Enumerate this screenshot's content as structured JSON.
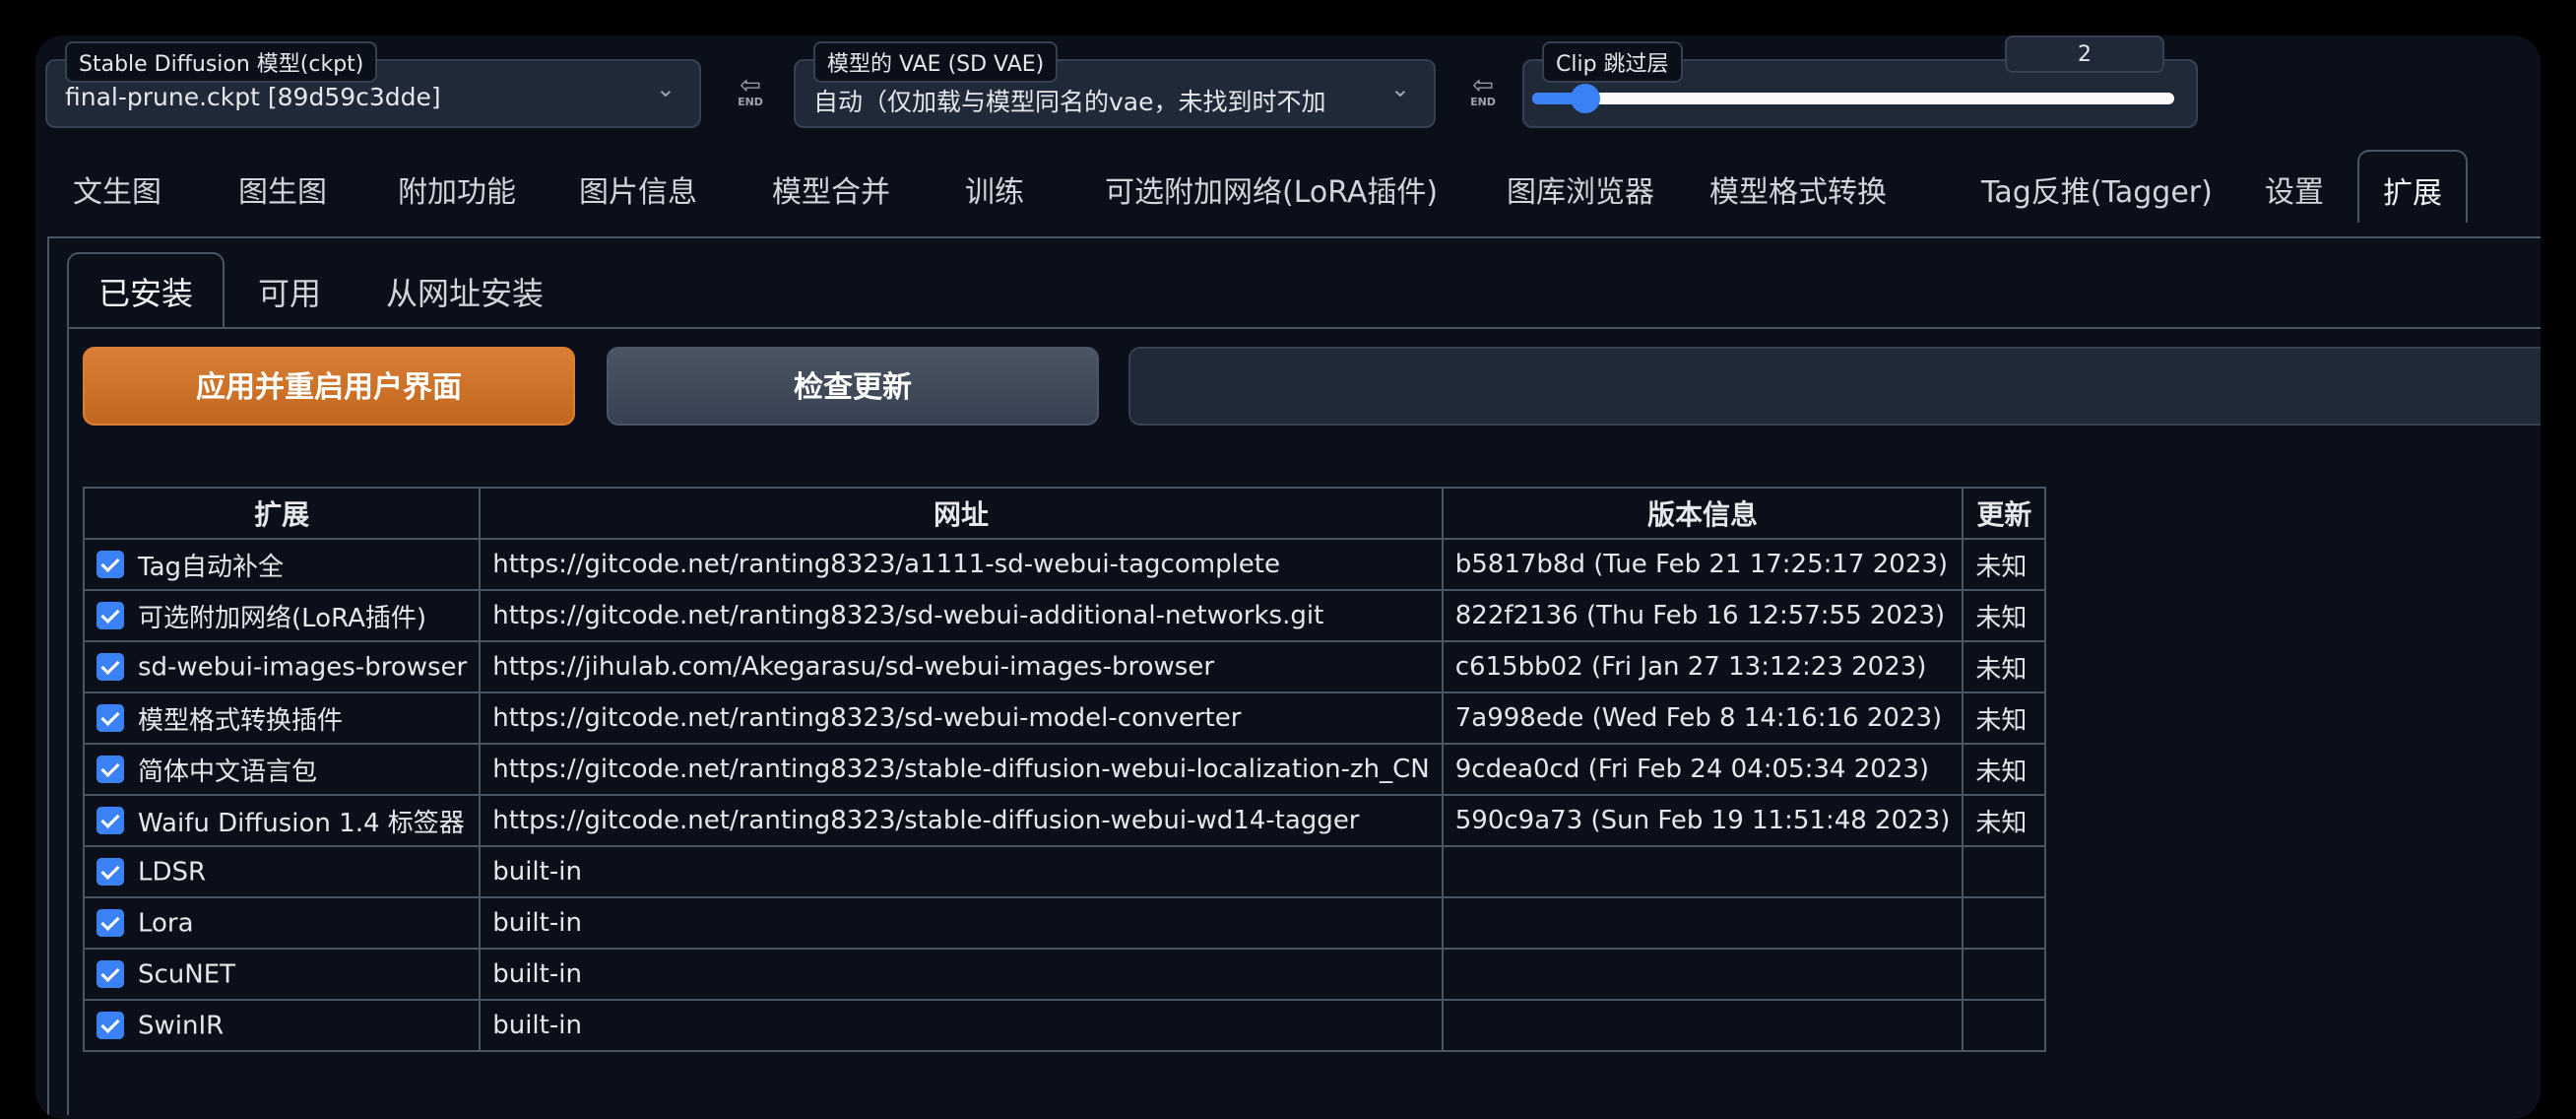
{
  "settings": {
    "checkpoint": {
      "label": "Stable Diffusion 模型(ckpt)",
      "value": "final-prune.ckpt [89d59c3dde]"
    },
    "vae": {
      "label": "模型的 VAE (SD VAE)",
      "value": "自动（仅加载与模型同名的vae，未找到时不加"
    },
    "clip": {
      "label": "Clip 跳过层",
      "value": "2",
      "level": 0.083
    },
    "end_icon_text": "END"
  },
  "main_tabs": [
    "文生图",
    "图生图",
    "附加功能",
    "图片信息",
    "模型合并",
    "训练",
    "可选附加网络(LoRA插件)",
    "图库浏览器",
    "模型格式转换",
    "Tag反推(Tagger)",
    "设置",
    "扩展"
  ],
  "sub_tabs": [
    "已安装",
    "可用",
    "从网址安装"
  ],
  "buttons": {
    "apply": "应用并重启用户界面",
    "check": "检查更新"
  },
  "table": {
    "headers": [
      "扩展",
      "网址",
      "版本信息",
      "更新"
    ],
    "rows": [
      {
        "name": "Tag自动补全",
        "url": "https://gitcode.net/ranting8323/a1111-sd-webui-tagcomplete",
        "version": "b5817b8d (Tue Feb 21 17:25:17 2023)",
        "update": "未知"
      },
      {
        "name": "可选附加网络(LoRA插件)",
        "url": "https://gitcode.net/ranting8323/sd-webui-additional-networks.git",
        "version": "822f2136 (Thu Feb 16 12:57:55 2023)",
        "update": "未知"
      },
      {
        "name": "sd-webui-images-browser",
        "url": "https://jihulab.com/Akegarasu/sd-webui-images-browser",
        "version": "c615bb02 (Fri Jan 27 13:12:23 2023)",
        "update": "未知"
      },
      {
        "name": "模型格式转换插件",
        "url": "https://gitcode.net/ranting8323/sd-webui-model-converter",
        "version": "7a998ede (Wed Feb 8 14:16:16 2023)",
        "update": "未知"
      },
      {
        "name": "简体中文语言包",
        "url": "https://gitcode.net/ranting8323/stable-diffusion-webui-localization-zh_CN",
        "version": "9cdea0cd (Fri Feb 24 04:05:34 2023)",
        "update": "未知"
      },
      {
        "name": "Waifu Diffusion 1.4 标签器",
        "url": "https://gitcode.net/ranting8323/stable-diffusion-webui-wd14-tagger",
        "version": "590c9a73 (Sun Feb 19 11:51:48 2023)",
        "update": "未知"
      },
      {
        "name": "LDSR",
        "url": "built-in",
        "version": "",
        "update": ""
      },
      {
        "name": "Lora",
        "url": "built-in",
        "version": "",
        "update": ""
      },
      {
        "name": "ScuNET",
        "url": "built-in",
        "version": "",
        "update": ""
      },
      {
        "name": "SwinIR",
        "url": "built-in",
        "version": "",
        "update": ""
      }
    ]
  },
  "colors": {
    "accent": "#3b82f6",
    "apply_button": "#c2671f",
    "background": "#0b0f19"
  }
}
